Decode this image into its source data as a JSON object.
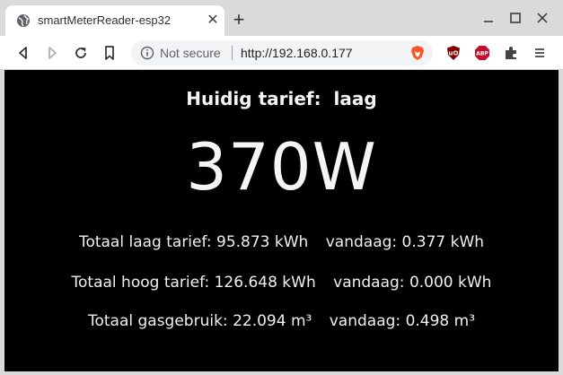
{
  "browser": {
    "tab_title": "smartMeterReader-esp32",
    "security_label": "Not secure",
    "url": "http://192.168.0.177"
  },
  "icons": {
    "favicon": "globe-icon",
    "tab_close": "close-icon",
    "new_tab": "plus-icon",
    "back": "back-arrow-icon",
    "forward": "forward-arrow-icon",
    "reload": "reload-icon",
    "bookmark": "bookmark-icon",
    "info": "info-icon",
    "brave": "brave-shield-icon",
    "ublock": "ublock-icon",
    "adblock": "adblock-plus-icon",
    "extensions": "puzzle-icon",
    "menu": "menu-icon"
  },
  "page": {
    "tariff_label": "Huidig tarief:",
    "tariff_value": "laag",
    "power": "370W",
    "stats": [
      {
        "label": "Totaal laag tarief:",
        "total": "95.873 kWh",
        "today_label": "vandaag:",
        "today": "0.377 kWh"
      },
      {
        "label": "Totaal hoog tarief:",
        "total": "126.648 kWh",
        "today_label": "vandaag:",
        "today": "0.000 kWh"
      },
      {
        "label": "Totaal gasgebruik:",
        "total": "22.094 m³",
        "today_label": "vandaag:",
        "today": "0.498 m³"
      }
    ]
  },
  "colors": {
    "page_background": "#000000",
    "page_text": "#f2f2f2",
    "brave_orange": "#fb542b",
    "ublock_red": "#800000",
    "abp_red": "#c70d2c"
  }
}
